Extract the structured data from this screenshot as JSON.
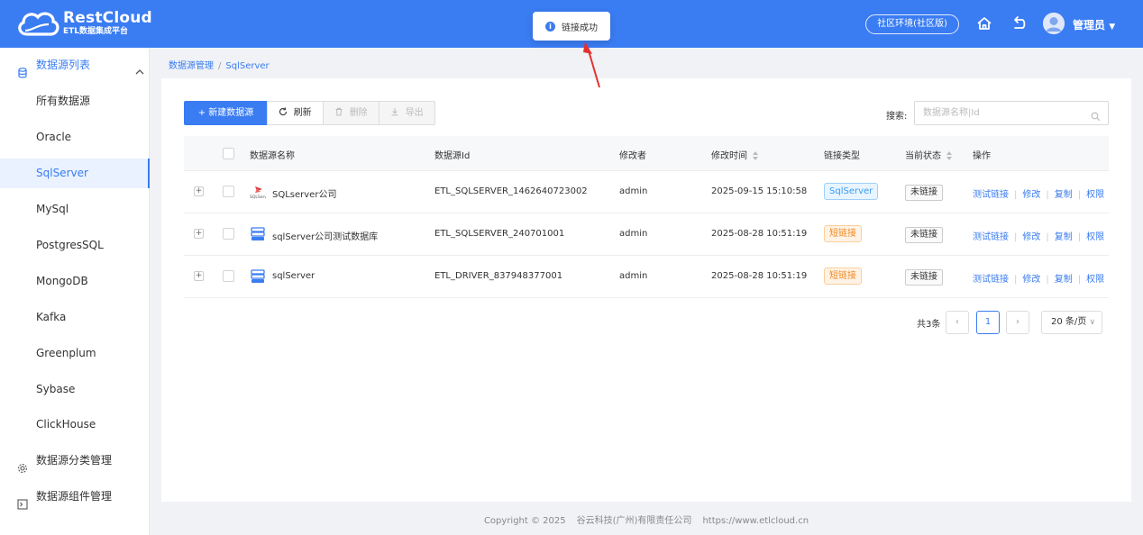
{
  "header": {
    "logo_title": "RestCloud",
    "logo_subtitle": "ETL数据集成平台",
    "env_label": "社区环境(社区版)",
    "home_icon": "home-icon",
    "back_icon": "undo-icon",
    "user_name": "管理员",
    "bg_color": "#3a7cf2"
  },
  "toast": {
    "message": "链接成功",
    "icon": "info-icon"
  },
  "sidebar": {
    "group_title": "数据源列表",
    "items": [
      {
        "label": "所有数据源"
      },
      {
        "label": "Oracle"
      },
      {
        "label": "SqlServer",
        "active": true
      },
      {
        "label": "MySql"
      },
      {
        "label": "PostgresSQL"
      },
      {
        "label": "MongoDB"
      },
      {
        "label": "Kafka"
      },
      {
        "label": "Greenplum"
      },
      {
        "label": "Sybase"
      },
      {
        "label": "ClickHouse"
      }
    ],
    "category_label": "数据源分类管理",
    "component_label": "数据源组件管理"
  },
  "breadcrumb": {
    "root": "数据源管理",
    "separator": "/",
    "current": "SqlServer"
  },
  "toolbar": {
    "new_label": "新建数据源",
    "refresh_label": "刷新",
    "delete_label": "删除",
    "export_label": "导出"
  },
  "search": {
    "label": "搜索:",
    "placeholder": "数据源名称|Id"
  },
  "table": {
    "columns": [
      "数据源名称",
      "数据源Id",
      "修改者",
      "修改时间",
      "链接类型",
      "当前状态",
      "操作"
    ],
    "rows": [
      {
        "name": "SQLserver公司",
        "id": "ETL_SQLSERVER_1462640723002",
        "modifier": "admin",
        "time": "2025-09-15 15:10:58",
        "link_type": "SqlServer",
        "status": "未链接"
      },
      {
        "name": "sqlServer公司测试数据库",
        "id": "ETL_SQLSERVER_240701001",
        "modifier": "admin",
        "time": "2025-08-28 10:51:19",
        "link_type": "短链接",
        "status": "未链接"
      },
      {
        "name": "sqlServer",
        "id": "ETL_DRIVER_837948377001",
        "modifier": "admin",
        "time": "2025-08-28 10:51:19",
        "link_type": "短链接",
        "status": "未链接"
      }
    ],
    "actions": [
      "测试链接",
      "修改",
      "复制",
      "权限"
    ],
    "action_separator": "|"
  },
  "pagination": {
    "total": "共3条",
    "current_page": "1",
    "page_size": "20 条/页"
  },
  "footer": {
    "copyright": "Copyright © 2025",
    "company": "谷云科技(广州)有限责任公司",
    "url": "https://www.etlcloud.cn"
  },
  "colors": {
    "primary": "#3a7cf2",
    "tag_blue": "#3a9cf2",
    "tag_orange": "#f08a24",
    "annotation_arrow": "#e53030"
  }
}
